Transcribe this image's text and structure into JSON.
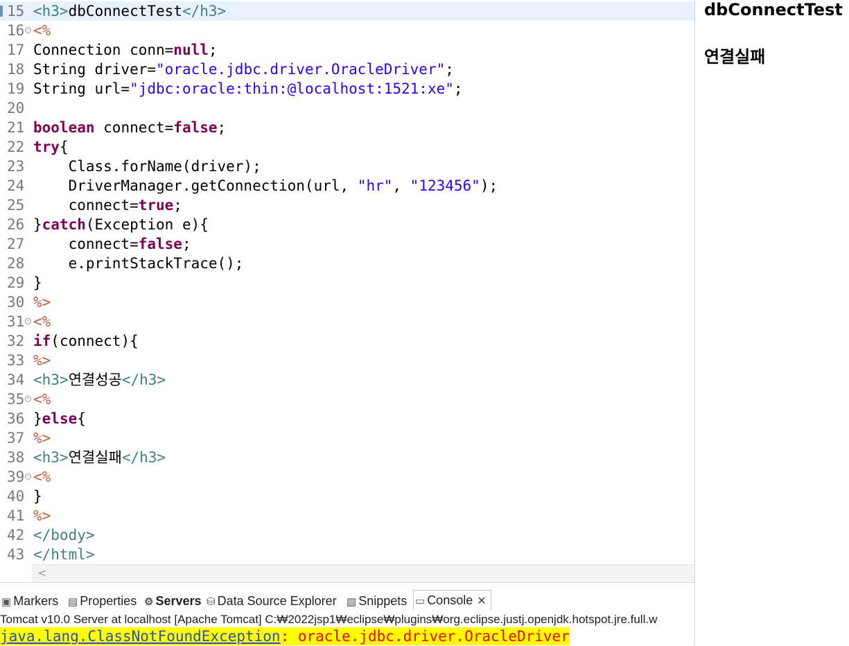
{
  "editor": {
    "lines": [
      {
        "num": "15",
        "fold": false,
        "current": true,
        "segments": [
          {
            "c": "tag",
            "t": "<h3>"
          },
          {
            "c": "",
            "t": "dbConnectTest"
          },
          {
            "c": "tag",
            "t": "</h3>"
          }
        ]
      },
      {
        "num": "16",
        "fold": true,
        "segments": [
          {
            "c": "jsp",
            "t": "<%"
          }
        ]
      },
      {
        "num": "17",
        "fold": false,
        "segments": [
          {
            "c": "",
            "t": "Connection conn="
          },
          {
            "c": "kw",
            "t": "null"
          },
          {
            "c": "",
            "t": ";"
          }
        ]
      },
      {
        "num": "18",
        "fold": false,
        "segments": [
          {
            "c": "",
            "t": "String driver="
          },
          {
            "c": "str",
            "t": "\"oracle.jdbc.driver.OracleDriver\""
          },
          {
            "c": "",
            "t": ";"
          }
        ]
      },
      {
        "num": "19",
        "fold": false,
        "segments": [
          {
            "c": "",
            "t": "String url="
          },
          {
            "c": "str",
            "t": "\"jdbc:oracle:thin:@localhost:1521:xe\""
          },
          {
            "c": "",
            "t": ";"
          }
        ]
      },
      {
        "num": "20",
        "fold": false,
        "segments": []
      },
      {
        "num": "21",
        "fold": false,
        "segments": [
          {
            "c": "kw",
            "t": "boolean"
          },
          {
            "c": "",
            "t": " connect="
          },
          {
            "c": "kw",
            "t": "false"
          },
          {
            "c": "",
            "t": ";"
          }
        ]
      },
      {
        "num": "22",
        "fold": false,
        "segments": [
          {
            "c": "kw",
            "t": "try"
          },
          {
            "c": "",
            "t": "{"
          }
        ]
      },
      {
        "num": "23",
        "fold": false,
        "segments": [
          {
            "c": "",
            "t": "    Class.forName(driver);"
          }
        ]
      },
      {
        "num": "24",
        "fold": false,
        "segments": [
          {
            "c": "",
            "t": "    DriverManager.getConnection(url, "
          },
          {
            "c": "str",
            "t": "\"hr\""
          },
          {
            "c": "",
            "t": ", "
          },
          {
            "c": "str",
            "t": "\"123456\""
          },
          {
            "c": "",
            "t": ");"
          }
        ]
      },
      {
        "num": "25",
        "fold": false,
        "segments": [
          {
            "c": "",
            "t": "    connect="
          },
          {
            "c": "kw",
            "t": "true"
          },
          {
            "c": "",
            "t": ";"
          }
        ]
      },
      {
        "num": "26",
        "fold": false,
        "segments": [
          {
            "c": "",
            "t": "}"
          },
          {
            "c": "kw",
            "t": "catch"
          },
          {
            "c": "",
            "t": "(Exception e){"
          }
        ]
      },
      {
        "num": "27",
        "fold": false,
        "segments": [
          {
            "c": "",
            "t": "    connect="
          },
          {
            "c": "kw",
            "t": "false"
          },
          {
            "c": "",
            "t": ";"
          }
        ]
      },
      {
        "num": "28",
        "fold": false,
        "segments": [
          {
            "c": "",
            "t": "    e.printStackTrace();"
          }
        ]
      },
      {
        "num": "29",
        "fold": false,
        "segments": [
          {
            "c": "",
            "t": "}"
          }
        ]
      },
      {
        "num": "30",
        "fold": false,
        "segments": [
          {
            "c": "jsp",
            "t": "%>"
          }
        ]
      },
      {
        "num": "31",
        "fold": true,
        "segments": [
          {
            "c": "jsp",
            "t": "<%"
          }
        ]
      },
      {
        "num": "32",
        "fold": false,
        "segments": [
          {
            "c": "kw",
            "t": "if"
          },
          {
            "c": "",
            "t": "(connect){"
          }
        ]
      },
      {
        "num": "33",
        "fold": false,
        "segments": [
          {
            "c": "jsp",
            "t": "%>"
          }
        ]
      },
      {
        "num": "34",
        "fold": false,
        "segments": [
          {
            "c": "tag",
            "t": "<h3>"
          },
          {
            "c": "",
            "t": "연결성공"
          },
          {
            "c": "tag",
            "t": "</h3>"
          }
        ]
      },
      {
        "num": "35",
        "fold": true,
        "segments": [
          {
            "c": "jsp",
            "t": "<%"
          }
        ]
      },
      {
        "num": "36",
        "fold": false,
        "segments": [
          {
            "c": "",
            "t": "}"
          },
          {
            "c": "kw",
            "t": "else"
          },
          {
            "c": "",
            "t": "{"
          }
        ]
      },
      {
        "num": "37",
        "fold": false,
        "segments": [
          {
            "c": "jsp",
            "t": "%>"
          }
        ]
      },
      {
        "num": "38",
        "fold": false,
        "segments": [
          {
            "c": "tag",
            "t": "<h3>"
          },
          {
            "c": "",
            "t": "연결실패"
          },
          {
            "c": "tag",
            "t": "</h3>"
          }
        ]
      },
      {
        "num": "39",
        "fold": true,
        "segments": [
          {
            "c": "jsp",
            "t": "<%"
          }
        ]
      },
      {
        "num": "40",
        "fold": false,
        "segments": [
          {
            "c": "",
            "t": "}"
          }
        ]
      },
      {
        "num": "41",
        "fold": false,
        "segments": [
          {
            "c": "jsp",
            "t": "%>"
          }
        ]
      },
      {
        "num": "42",
        "fold": false,
        "segments": [
          {
            "c": "tag",
            "t": "</body>"
          }
        ]
      },
      {
        "num": "43",
        "fold": false,
        "segments": [
          {
            "c": "tag",
            "t": "</html>"
          }
        ]
      }
    ],
    "scroll_left_icon": "chevron-left-icon",
    "scroll_left_glyph": "<"
  },
  "preview": {
    "title": "dbConnectTest",
    "result": "연결실패"
  },
  "panel": {
    "tabs": [
      {
        "id": "markers",
        "label": "Markers",
        "icon": "markers-icon",
        "glyph": "▣",
        "active": false,
        "bold": false
      },
      {
        "id": "properties",
        "label": "Properties",
        "icon": "properties-icon",
        "glyph": "▤",
        "active": false,
        "bold": false
      },
      {
        "id": "servers",
        "label": "Servers",
        "icon": "servers-icon",
        "glyph": "⚙",
        "active": false,
        "bold": true
      },
      {
        "id": "data-source-explorer",
        "label": "Data Source Explorer",
        "icon": "database-icon",
        "glyph": "⛁",
        "active": false,
        "bold": false
      },
      {
        "id": "snippets",
        "label": "Snippets",
        "icon": "snippets-icon",
        "glyph": "▧",
        "active": false,
        "bold": false
      },
      {
        "id": "console",
        "label": "Console",
        "icon": "console-icon",
        "glyph": "▭",
        "active": true,
        "bold": false
      }
    ],
    "close_glyph": "✕",
    "console_title": "Tomcat v10.0 Server at localhost [Apache Tomcat] C:₩2022jsp1₩eclipse₩plugins₩org.eclipse.justj.openjdk.hotspot.jre.full.w",
    "exception_class": "java.lang.ClassNotFoundException",
    "exception_message": ": oracle.jdbc.driver.OracleDriver"
  },
  "colors": {
    "tag": "#3f7f7f",
    "jsp_delimiter": "#bf5f3f",
    "keyword": "#7f0055",
    "string": "#2a00ff",
    "current_line": "#e8f2fe",
    "console_highlight": "#ffff00",
    "exception_link": "#2a4fb8",
    "exception_text": "#ff0000"
  }
}
